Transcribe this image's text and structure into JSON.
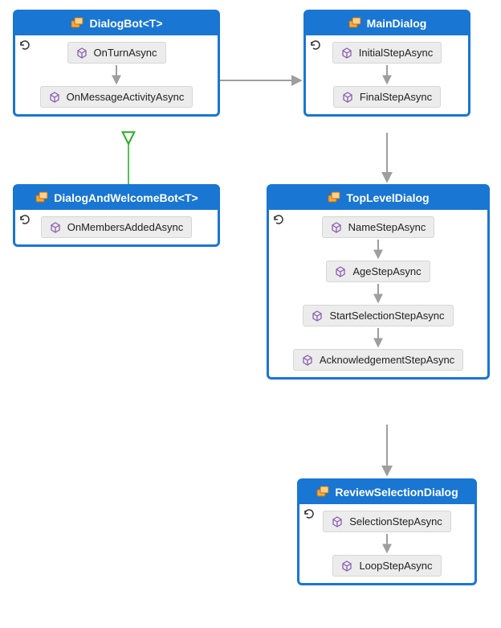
{
  "classes": {
    "dialogBot": {
      "title": "DialogBot<T>",
      "methods": [
        "OnTurnAsync",
        "OnMessageActivityAsync"
      ]
    },
    "dialogAndWelcomeBot": {
      "title": "DialogAndWelcomeBot<T>",
      "methods": [
        "OnMembersAddedAsync"
      ]
    },
    "mainDialog": {
      "title": "MainDialog",
      "methods": [
        "InitialStepAsync",
        "FinalStepAsync"
      ]
    },
    "topLevelDialog": {
      "title": "TopLevelDialog",
      "methods": [
        "NameStepAsync",
        "AgeStepAsync",
        "StartSelectionStepAsync",
        "AcknowledgementStepAsync"
      ]
    },
    "reviewSelectionDialog": {
      "title": "ReviewSelectionDialog",
      "methods": [
        "SelectionStepAsync",
        "LoopStepAsync"
      ]
    }
  },
  "chart_data": {
    "type": "diagram",
    "title": "",
    "nodes": [
      {
        "id": "dialogBot",
        "label": "DialogBot<T>",
        "methods": [
          "OnTurnAsync",
          "OnMessageActivityAsync"
        ]
      },
      {
        "id": "dialogAndWelcomeBot",
        "label": "DialogAndWelcomeBot<T>",
        "methods": [
          "OnMembersAddedAsync"
        ]
      },
      {
        "id": "mainDialog",
        "label": "MainDialog",
        "methods": [
          "InitialStepAsync",
          "FinalStepAsync"
        ]
      },
      {
        "id": "topLevelDialog",
        "label": "TopLevelDialog",
        "methods": [
          "NameStepAsync",
          "AgeStepAsync",
          "StartSelectionStepAsync",
          "AcknowledgementStepAsync"
        ]
      },
      {
        "id": "reviewSelectionDialog",
        "label": "ReviewSelectionDialog",
        "methods": [
          "SelectionStepAsync",
          "LoopStepAsync"
        ]
      }
    ],
    "edges": [
      {
        "from": "dialogAndWelcomeBot",
        "to": "dialogBot",
        "type": "inheritance"
      },
      {
        "from": "dialogBot",
        "to": "mainDialog",
        "type": "association"
      },
      {
        "from": "mainDialog",
        "to": "topLevelDialog",
        "type": "association"
      },
      {
        "from": "topLevelDialog",
        "to": "reviewSelectionDialog",
        "type": "association"
      }
    ],
    "internal_flows": [
      {
        "class": "dialogBot",
        "sequence": [
          "OnTurnAsync",
          "OnMessageActivityAsync"
        ]
      },
      {
        "class": "mainDialog",
        "sequence": [
          "InitialStepAsync",
          "FinalStepAsync"
        ]
      },
      {
        "class": "topLevelDialog",
        "sequence": [
          "NameStepAsync",
          "AgeStepAsync",
          "StartSelectionStepAsync",
          "AcknowledgementStepAsync"
        ]
      },
      {
        "class": "reviewSelectionDialog",
        "sequence": [
          "SelectionStepAsync",
          "LoopStepAsync"
        ]
      }
    ]
  }
}
